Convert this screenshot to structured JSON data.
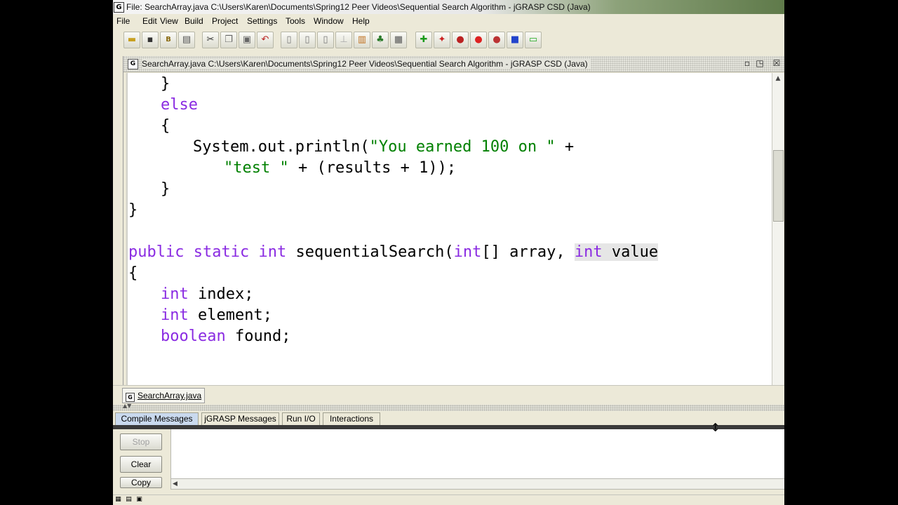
{
  "window": {
    "app_icon": "G",
    "title": "File: SearchArray.java  C:\\Users\\Karen\\Documents\\Spring12 Peer Videos\\Sequential Search Algorithm - jGRASP CSD (Java)"
  },
  "menu": [
    "File",
    "Edit",
    "View",
    "Build",
    "Project",
    "Settings",
    "Tools",
    "Window",
    "Help"
  ],
  "toolbar": {
    "icons": [
      "open-folder-icon",
      "save-icon",
      "backup-icon",
      "print-icon",
      "cut-icon",
      "copy-icon",
      "paste-icon",
      "undo-icon",
      "document-icon",
      "document-icon",
      "document-icon",
      "pin-icon",
      "chart-icon",
      "tree-icon",
      "book-icon",
      "compile-plus-icon",
      "run-figure-icon",
      "bug-icon",
      "apple-icon",
      "bug-step-icon",
      "stop-square-icon",
      "display-icon"
    ]
  },
  "internal_frame": {
    "icon": "G",
    "title": "SearchArray.java  C:\\Users\\Karen\\Documents\\Spring12 Peer Videos\\Sequential Search Algorithm - jGRASP CSD (Java)",
    "buttons": [
      "restore-icon",
      "maximize-icon",
      "close-icon"
    ]
  },
  "editor": {
    "font_color": "#000000",
    "keyword_color": "#8a2be2",
    "string_color": "#008000",
    "lines": [
      {
        "indent": 2,
        "tokens": [
          {
            "t": "}"
          }
        ]
      },
      {
        "indent": 2,
        "tokens": [
          {
            "t": "else",
            "c": "kw"
          }
        ]
      },
      {
        "indent": 2,
        "tokens": [
          {
            "t": "{"
          }
        ]
      },
      {
        "indent": 3,
        "tokens": [
          {
            "t": "System.out.println("
          },
          {
            "t": "\"You earned 100 on \"",
            "c": "str"
          },
          {
            "t": " +"
          }
        ]
      },
      {
        "indent": 4,
        "tokens": [
          {
            "t": "\"test \"",
            "c": "str"
          },
          {
            "t": " + (results + 1));"
          }
        ]
      },
      {
        "indent": 2,
        "tokens": [
          {
            "t": "}"
          }
        ]
      },
      {
        "indent": 1,
        "tokens": [
          {
            "t": "}"
          }
        ]
      },
      {
        "indent": 1,
        "tokens": []
      },
      {
        "indent": 1,
        "tokens": [
          {
            "t": "public",
            "c": "kw"
          },
          {
            "t": " "
          },
          {
            "t": "static",
            "c": "kw"
          },
          {
            "t": " "
          },
          {
            "t": "int",
            "c": "kw"
          },
          {
            "t": " sequentialSearch("
          },
          {
            "t": "int",
            "c": "kw"
          },
          {
            "t": "[] array, "
          },
          {
            "t": "int",
            "c": "kw hl"
          },
          {
            "t": " value",
            "c": "hl"
          }
        ]
      },
      {
        "indent": 1,
        "tokens": [
          {
            "t": "{"
          }
        ]
      },
      {
        "indent": 2,
        "tokens": [
          {
            "t": "int",
            "c": "kw"
          },
          {
            "t": " index;"
          }
        ]
      },
      {
        "indent": 2,
        "tokens": [
          {
            "t": "int",
            "c": "kw"
          },
          {
            "t": " element;"
          }
        ]
      },
      {
        "indent": 2,
        "tokens": [
          {
            "t": "boolean",
            "c": "kw"
          },
          {
            "t": " found;"
          }
        ]
      }
    ]
  },
  "file_tab": {
    "icon": "G",
    "label": "SearchArray.java"
  },
  "message_tabs": [
    {
      "label": "Compile Messages",
      "active": true
    },
    {
      "label": "jGRASP Messages",
      "active": false
    },
    {
      "label": "Run I/O",
      "active": false
    },
    {
      "label": "Interactions",
      "active": false
    }
  ],
  "message_buttons": [
    {
      "label": "Stop",
      "enabled": false
    },
    {
      "label": "Clear",
      "enabled": true
    },
    {
      "label": "Copy",
      "enabled": true
    }
  ],
  "status_icons": [
    "tile-icon",
    "list-icon",
    "window-icon"
  ]
}
